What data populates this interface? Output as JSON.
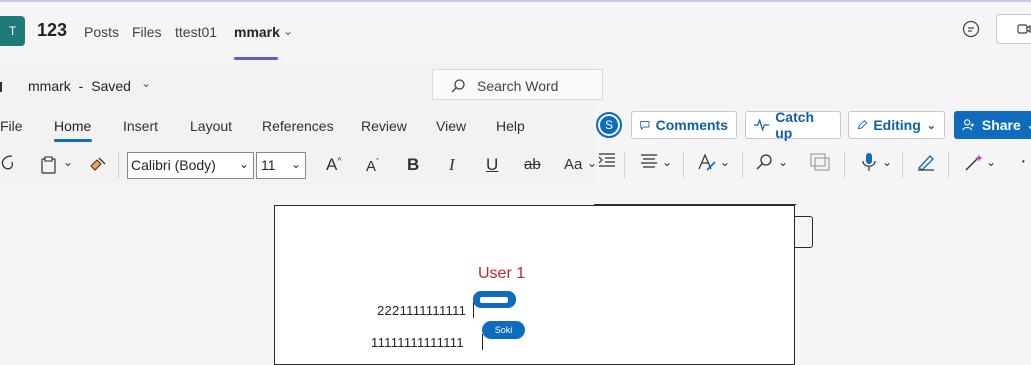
{
  "teams": {
    "team_initial": "T",
    "channel_name": "123",
    "tabs": [
      "Posts",
      "Files",
      "ttest01",
      "mmark"
    ],
    "active_tab_chevron": "⌄",
    "icons": [
      "chat-icon",
      "video-icon"
    ]
  },
  "word": {
    "doc_name": "mmark",
    "separator": "-",
    "save_status": "Saved",
    "search_placeholder": "Search Word",
    "ribbon_tabs": [
      "File",
      "Home",
      "Insert",
      "Layout",
      "References",
      "Review",
      "View",
      "Help"
    ],
    "active_ribbon_tab": "Home",
    "user_avatar_initial": "S",
    "comments_label": "Comments",
    "catchup_label": "Catch up",
    "editing_label": "Editing",
    "share_label": "Share",
    "font_name": "Calibri (Body)",
    "font_size": "11",
    "bold": "B",
    "italic": "I",
    "underline": "U",
    "strike": "ab",
    "font_grow": "A",
    "font_shrink": "A",
    "change_case": "Aa",
    "more": "·"
  },
  "document": {
    "user_label": "User 1",
    "line1": "2221111111111",
    "line2": "11111111111111",
    "presence_name": "Soki"
  },
  "colors": {
    "accent": "#0f6cbd",
    "teams_purple": "#5b5fc7",
    "user_label": "#c4262e",
    "team_avatar": "#1f7a7a"
  }
}
